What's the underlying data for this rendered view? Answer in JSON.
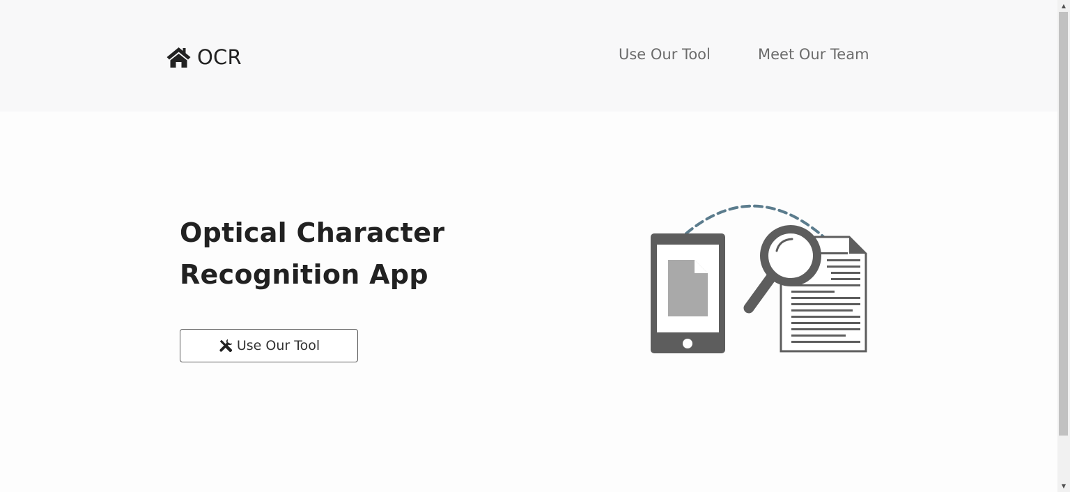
{
  "navbar": {
    "brand": {
      "icon": "home-icon",
      "label": "OCR"
    },
    "links": [
      {
        "label": "Use Our Tool"
      },
      {
        "label": "Meet Our Team"
      }
    ]
  },
  "hero": {
    "title_line1": "Optical Character",
    "title_line2": "Recognition App",
    "button": {
      "icon": "tools-icon",
      "label": "Use Our Tool"
    },
    "illustration": "phone-document-magnifier-illustration"
  },
  "scrollbar": {
    "up_icon": "scroll-up-arrow-icon",
    "down_icon": "scroll-down-arrow-icon"
  },
  "colors": {
    "navbar_bg": "#f8f8f9",
    "page_bg": "#fdfdfd",
    "title": "#212121",
    "nav_link": "#6c6c6c",
    "illustration_gray": "#5d5d5d",
    "illustration_dash": "#5b7c8d"
  }
}
